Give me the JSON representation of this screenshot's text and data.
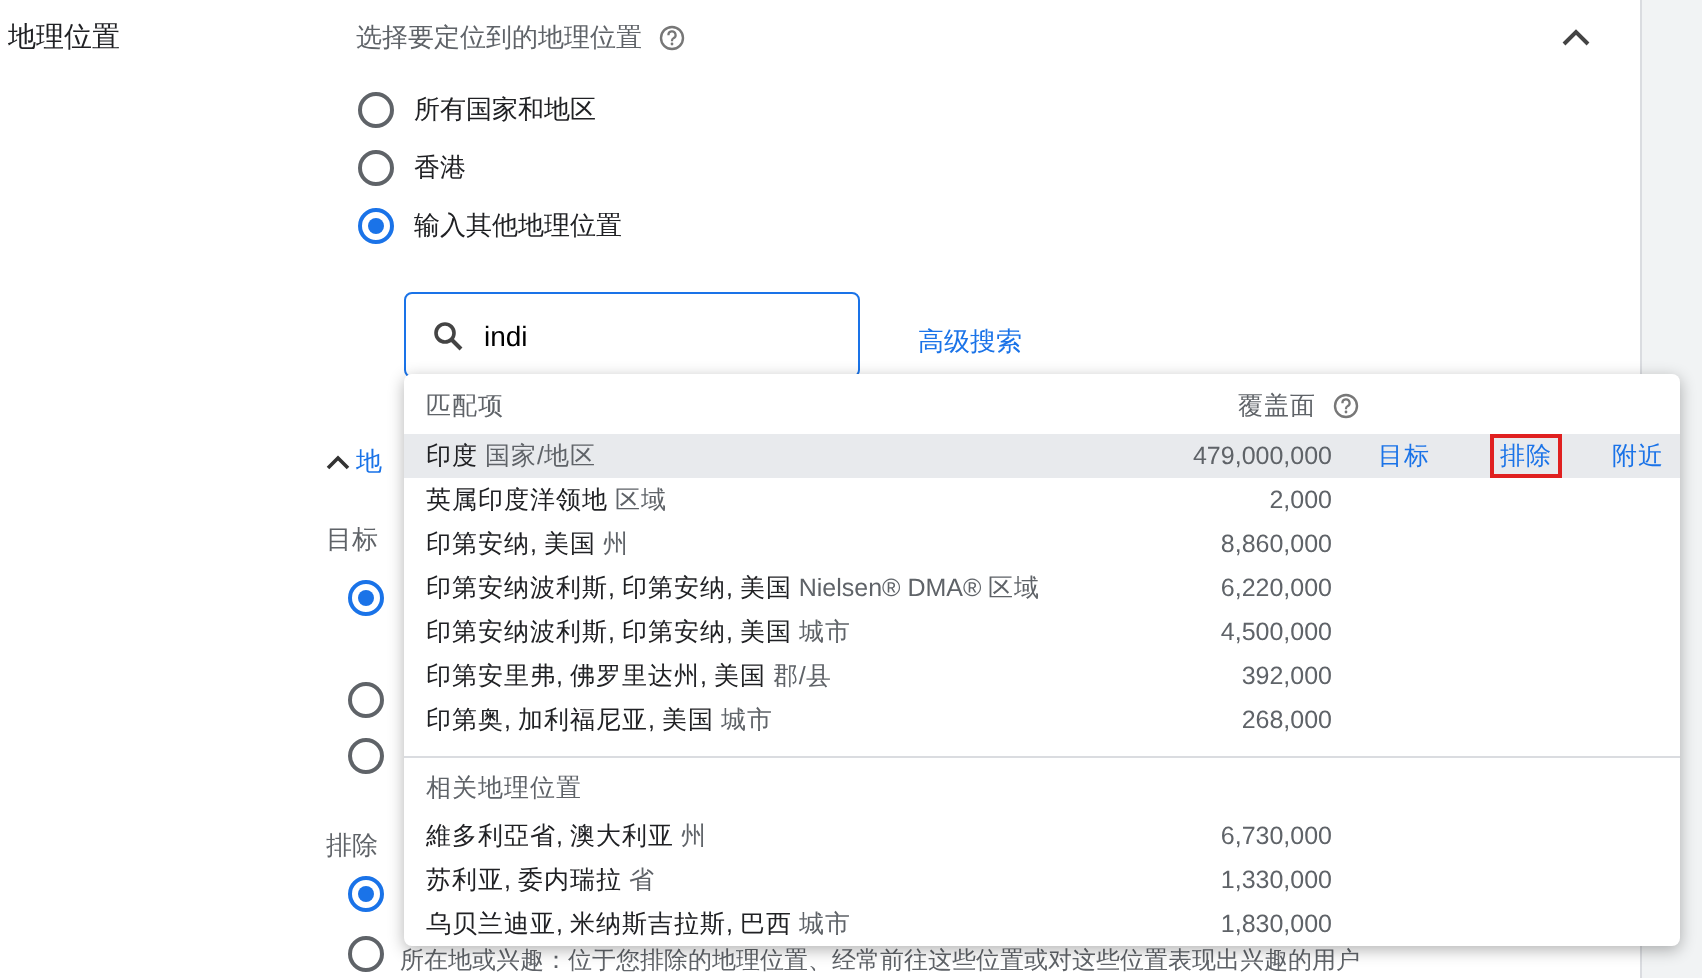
{
  "section_label": "地理位置",
  "location": {
    "title": "选择要定位到的地理位置",
    "expanded": true,
    "options": [
      {
        "label": "所有国家和地区",
        "selected": false
      },
      {
        "label": "香港",
        "selected": false
      },
      {
        "label": "输入其他地理位置",
        "selected": true
      }
    ],
    "search": {
      "value": "indi"
    },
    "advanced_search": "高级搜索"
  },
  "options_section": {
    "label": "地",
    "expanded": true,
    "target_label": "目标",
    "target_options": [
      {
        "selected": true
      },
      {
        "selected": false
      },
      {
        "selected": false
      }
    ],
    "exclude_label": "排除",
    "exclude_options": [
      {
        "selected": true
      },
      {
        "label": "所在地或兴趣：位于您排除的地理位置、经常前往这些位置或对这些位置表现出兴趣的用户",
        "selected": false
      }
    ]
  },
  "dropdown": {
    "columns": [
      "匹配项",
      "覆盖面"
    ],
    "matches": [
      {
        "name": "印度",
        "type": "国家/地区",
        "reach": "479,000,000",
        "selected": true,
        "actions": [
          {
            "label": "目标",
            "highlighted": false
          },
          {
            "label": "排除",
            "highlighted": true
          },
          {
            "label": "附近",
            "highlighted": false
          }
        ]
      },
      {
        "name": "英属印度洋领地",
        "type": "区域",
        "reach": "2,000",
        "selected": false
      },
      {
        "name": "印第安纳, 美国",
        "type": "州",
        "reach": "8,860,000",
        "selected": false
      },
      {
        "name": "印第安纳波利斯, 印第安纳, 美国",
        "type": "Nielsen® DMA® 区域",
        "reach": "6,220,000",
        "selected": false
      },
      {
        "name": "印第安纳波利斯, 印第安纳, 美国",
        "type": "城市",
        "reach": "4,500,000",
        "selected": false
      },
      {
        "name": "印第安里弗, 佛罗里达州, 美国",
        "type": "郡/县",
        "reach": "392,000",
        "selected": false
      },
      {
        "name": "印第奥, 加利福尼亚, 美国",
        "type": "城市",
        "reach": "268,000",
        "selected": false
      }
    ],
    "related_title": "相关地理位置",
    "related": [
      {
        "name": "維多利亞省, 澳大利亚",
        "type": "州",
        "reach": "6,730,000",
        "selected": false
      },
      {
        "name": "苏利亚, 委内瑞拉",
        "type": "省",
        "reach": "1,330,000",
        "selected": false
      },
      {
        "name": "乌贝兰迪亚, 米纳斯吉拉斯, 巴西",
        "type": "城市",
        "reach": "1,830,000",
        "selected": false
      }
    ]
  }
}
